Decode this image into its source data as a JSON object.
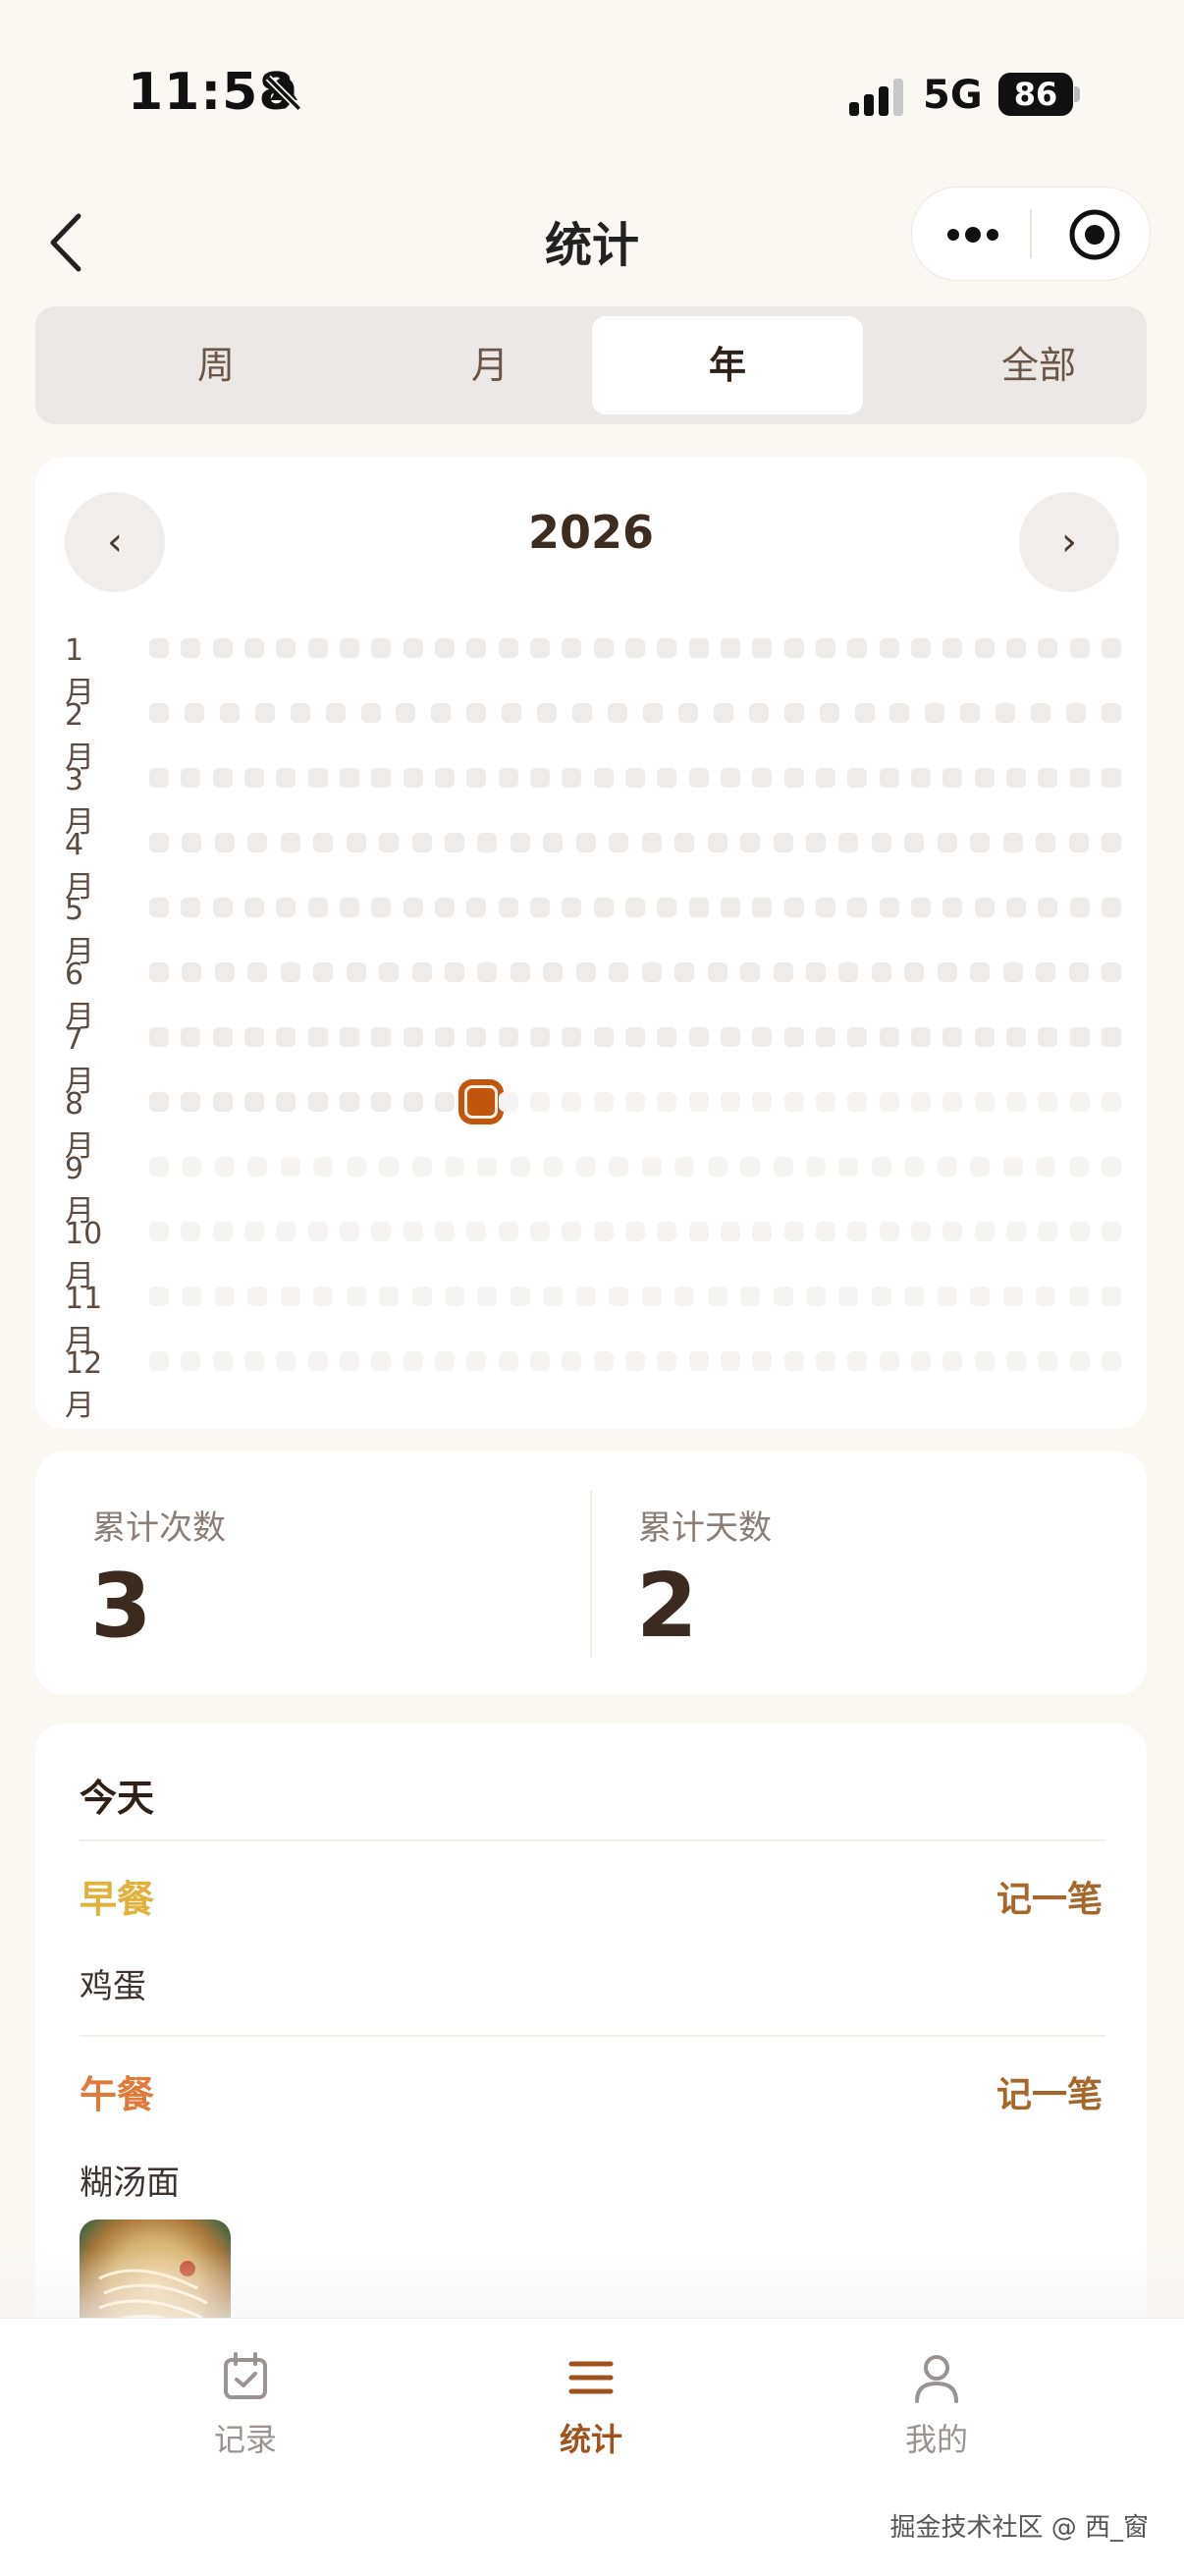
{
  "status_bar": {
    "time": "11:58",
    "network": "5G",
    "battery": "86"
  },
  "nav": {
    "title": "统计",
    "more_icon": "more-dots-icon",
    "target_icon": "target-icon"
  },
  "segments": [
    {
      "label": "周",
      "active": false
    },
    {
      "label": "月",
      "active": false
    },
    {
      "label": "年",
      "active": true
    },
    {
      "label": "全部",
      "active": false
    }
  ],
  "calendar": {
    "year": "2026",
    "prev_label": "‹",
    "next_label": "›",
    "months": [
      "1月",
      "2月",
      "3月",
      "4月",
      "5月",
      "6月",
      "7月",
      "8月",
      "9月",
      "10月",
      "11月",
      "12月"
    ],
    "highlight": {
      "month": 8,
      "day": 11
    }
  },
  "stats": {
    "total_count_label": "累计次数",
    "total_count": "3",
    "total_days_label": "累计天数",
    "total_days": "2"
  },
  "today": {
    "title": "今天",
    "meals": [
      {
        "name": "早餐",
        "action": "记一笔",
        "food": "鸡蛋",
        "color": "#e0b23c"
      },
      {
        "name": "午餐",
        "action": "记一笔",
        "food": "糊汤面",
        "color": "#df7a3a"
      }
    ]
  },
  "tabbar": [
    {
      "label": "记录",
      "icon": "calendar-check-icon",
      "active": false
    },
    {
      "label": "统计",
      "icon": "list-icon",
      "active": true
    },
    {
      "label": "我的",
      "icon": "user-icon",
      "active": false
    }
  ],
  "watermark": "掘金技术社区 @ 西_窗",
  "colors": {
    "accent": "#a0521c",
    "highlight": "#c2560c",
    "cell_past": "#eeebe8",
    "cell_future": "#f6f4f2"
  }
}
